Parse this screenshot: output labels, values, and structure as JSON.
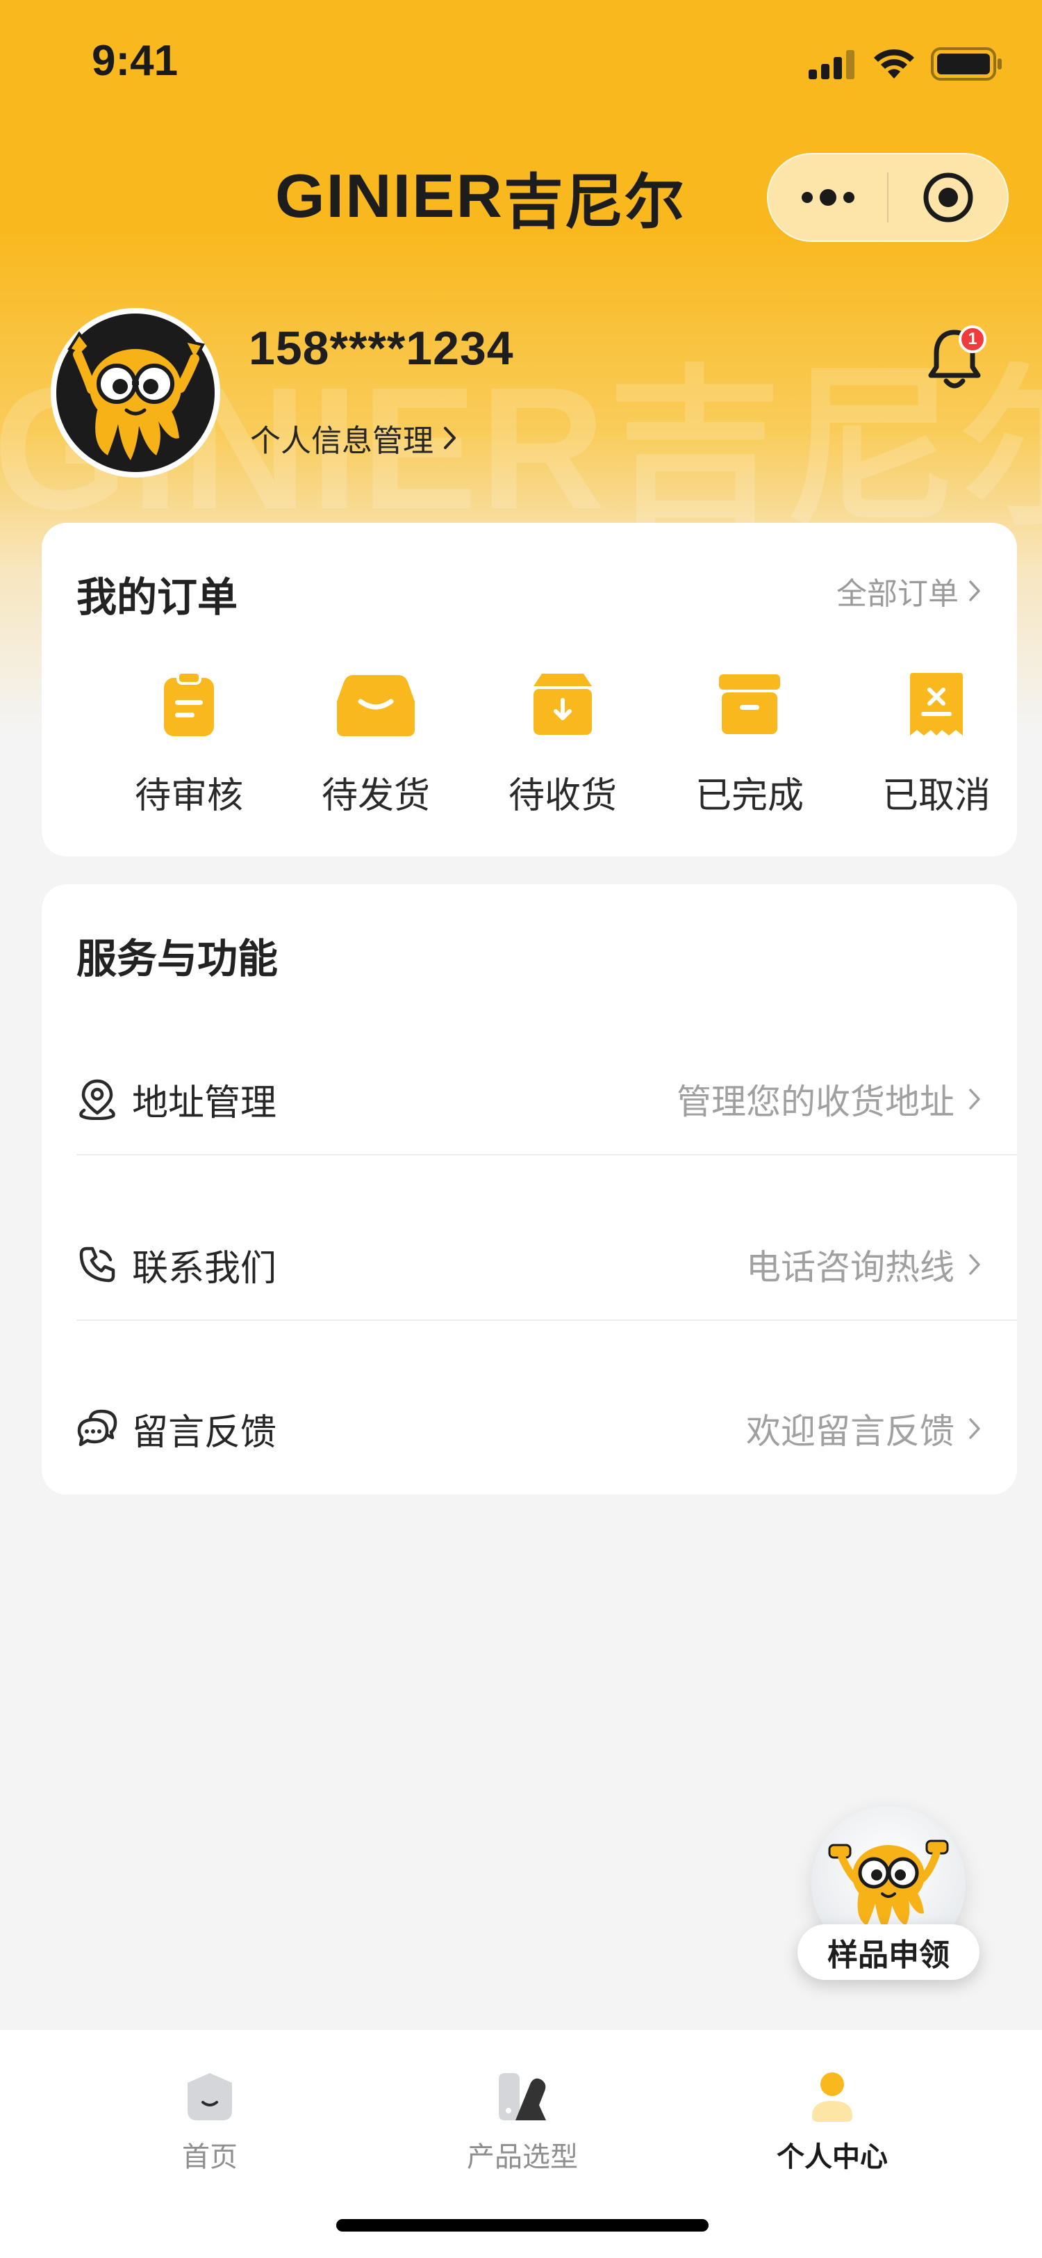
{
  "status_bar": {
    "time": "9:41"
  },
  "header": {
    "brand_en": "GINIER",
    "brand_cn": "吉尼尔",
    "watermark": "GINIER吉尼尔",
    "capsule": {
      "more_icon": "more-dots-icon",
      "close_icon": "target-circle-icon"
    }
  },
  "profile": {
    "phone": "158****1234",
    "info_link": "个人信息管理",
    "notification_badge": "1"
  },
  "orders": {
    "title": "我的订单",
    "all_link": "全部订单",
    "items": [
      {
        "label": "待审核",
        "icon": "clipboard-icon"
      },
      {
        "label": "待发货",
        "icon": "shipment-box-icon"
      },
      {
        "label": "待收货",
        "icon": "receive-box-icon"
      },
      {
        "label": "已完成",
        "icon": "archive-box-icon"
      },
      {
        "label": "已取消",
        "icon": "cancel-receipt-icon"
      }
    ]
  },
  "services": {
    "title": "服务与功能",
    "rows": [
      {
        "label": "地址管理",
        "hint": "管理您的收货地址",
        "icon": "location-pin-icon"
      },
      {
        "label": "联系我们",
        "hint": "电话咨询热线",
        "icon": "phone-icon"
      },
      {
        "label": "留言反馈",
        "hint": "欢迎留言反馈",
        "icon": "chat-bubbles-icon"
      }
    ]
  },
  "fab": {
    "label": "样品申领"
  },
  "tabbar": {
    "tabs": [
      {
        "label": "首页",
        "active": false
      },
      {
        "label": "产品选型",
        "active": false
      },
      {
        "label": "个人中心",
        "active": true
      }
    ]
  },
  "colors": {
    "accent": "#f9b81e",
    "badge": "#ef3b3b"
  }
}
